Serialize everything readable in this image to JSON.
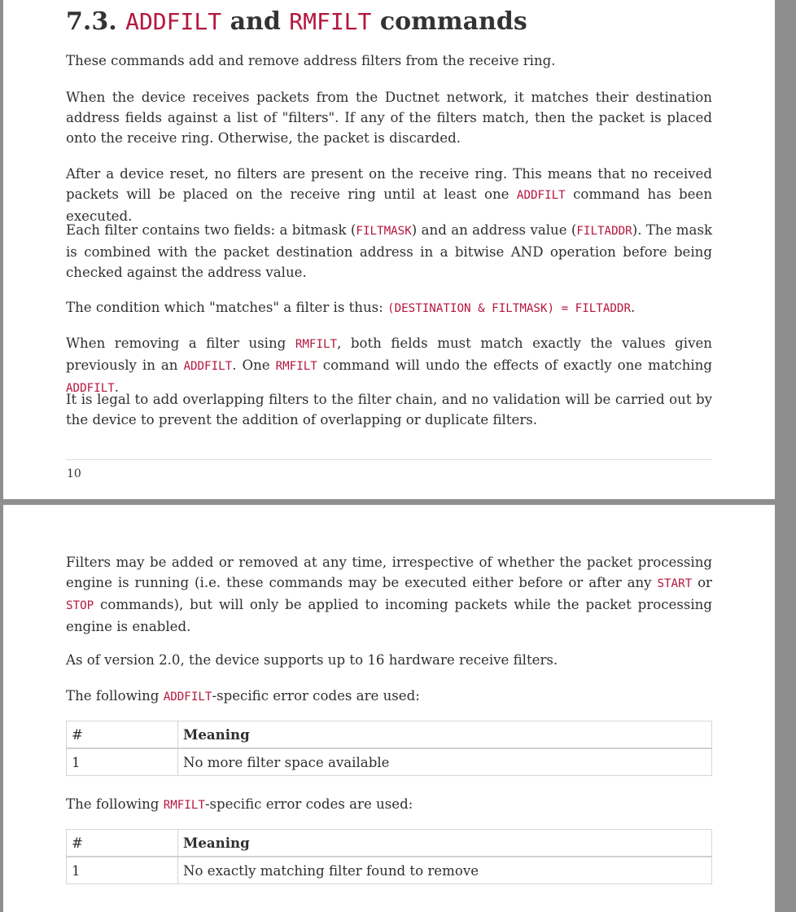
{
  "page1": {
    "heading": {
      "number": "7.3.",
      "cmd1": "ADDFILT",
      "and": "and",
      "cmd2": "RMFILT",
      "tail": "commands"
    },
    "p1": "These commands add and remove address filters from the receive ring.",
    "p2": "When the device receives packets from the Ductnet network, it matches their destination address fields against a list of \"filters\". If any of the filters match, then the packet is placed onto the receive ring. Otherwise, the packet is discarded.",
    "p3": {
      "a": "After a device reset, no filters are present on the receive ring. This means that no received packets will be placed on the receive ring until at least one ",
      "code": "ADDFILT",
      "b": " command has been executed."
    },
    "p4": {
      "a": "Each filter contains two fields: a bitmask (",
      "code1": "FILTMASK",
      "b": ") and an address value (",
      "code2": "FILTADDR",
      "c": "). The mask is combined with the packet destination address in a bitwise AND operation before being checked against the address value."
    },
    "p5": {
      "a": "The condition which \"matches\" a filter is thus: ",
      "code": "(DESTINATION & FILTMASK) = FILTADDR",
      "b": "."
    },
    "p6": {
      "a": "When removing a filter using ",
      "code1": "RMFILT",
      "b": ", both fields must match exactly the values given previously in an ",
      "code2": "ADDFILT",
      "c": ". One ",
      "code3": "RMFILT",
      "d": " command will undo the effects of exactly one matching ",
      "code4": "ADDFILT",
      "e": "."
    },
    "p7": "It is legal to add overlapping filters to the filter chain, and no validation will be carried out by the device to prevent the addition of overlapping or duplicate filters.",
    "page_number": "10"
  },
  "page2": {
    "p1": {
      "a": "Filters may be added or removed at any time, irrespective of whether the packet processing engine is running (i.e. these commands may be executed either before or after any ",
      "code1": "START",
      "b": " or ",
      "code2": "STOP",
      "c": " commands), but will only be applied to incoming packets while the packet processing engine is enabled."
    },
    "p2": "As of version 2.0, the device supports up to 16 hardware receive filters.",
    "p3": {
      "a": "The following ",
      "code": "ADDFILT",
      "b": "-specific error codes are used:"
    },
    "table1": {
      "col_num": "#",
      "col_meaning": "Meaning",
      "rows": [
        {
          "num": "1",
          "meaning": "No more filter space available"
        }
      ]
    },
    "p4": {
      "a": "The following ",
      "code": "RMFILT",
      "b": "-specific error codes are used:"
    },
    "table2": {
      "col_num": "#",
      "col_meaning": "Meaning",
      "rows": [
        {
          "num": "1",
          "meaning": "No exactly matching filter found to remove"
        }
      ]
    }
  }
}
